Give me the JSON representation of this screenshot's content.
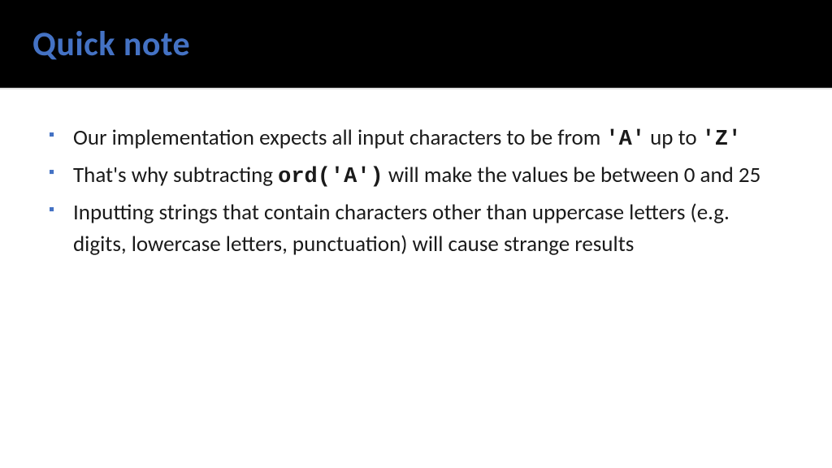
{
  "header": {
    "title": "Quick note"
  },
  "bullets": [
    {
      "parts": [
        {
          "text": "Our implementation expects all input characters to be from ",
          "mono": false
        },
        {
          "text": "'A'",
          "mono": true
        },
        {
          "text": " up to ",
          "mono": false
        },
        {
          "text": "'Z'",
          "mono": true
        }
      ]
    },
    {
      "parts": [
        {
          "text": "That's why subtracting ",
          "mono": false
        },
        {
          "text": "ord('A')",
          "mono": true
        },
        {
          "text": " will make the values be between 0 and 25",
          "mono": false
        }
      ]
    },
    {
      "parts": [
        {
          "text": "Inputting strings that contain characters other than uppercase letters (e.g. digits, lowercase letters, punctuation) will cause strange results",
          "mono": false
        }
      ]
    }
  ]
}
